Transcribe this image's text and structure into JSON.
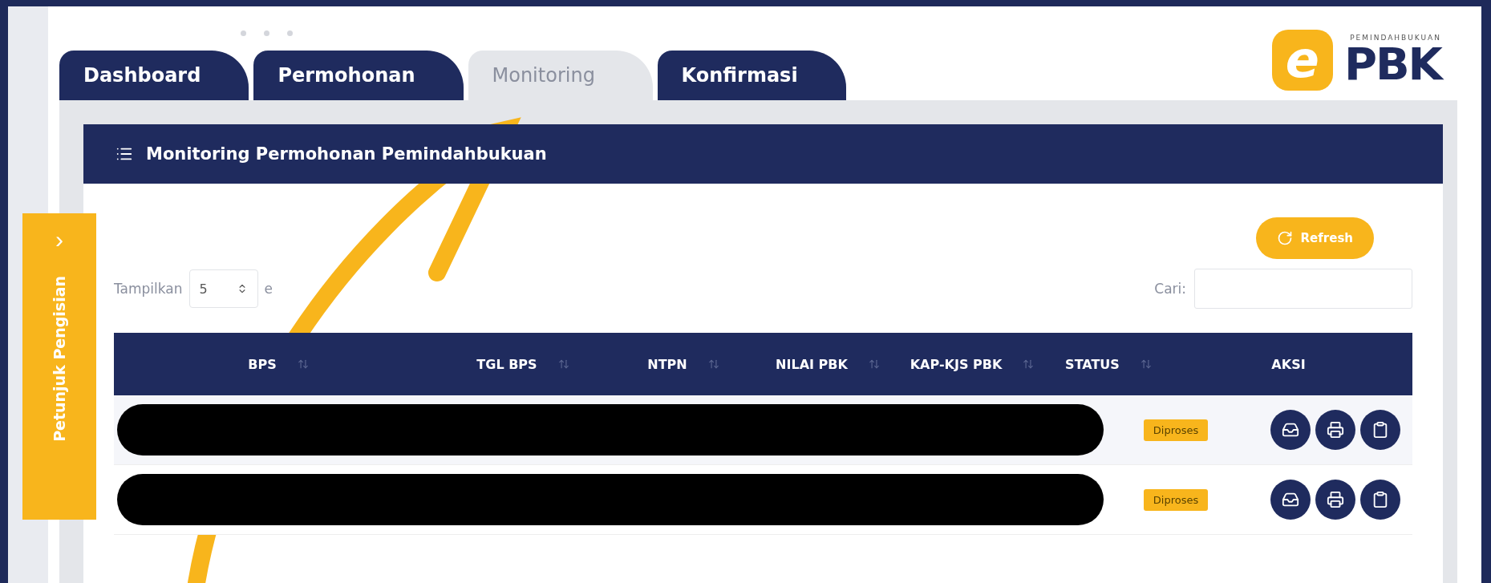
{
  "logo": {
    "mark": "e",
    "caption": "PEMINDAHBUKUAN",
    "name": "PBK"
  },
  "side_tab": {
    "label": "Petunjuk Pengisian",
    "icon": "›"
  },
  "tabs": [
    {
      "label": "Dashboard",
      "selected": false
    },
    {
      "label": "Permohonan",
      "selected": false
    },
    {
      "label": "Monitoring",
      "selected": true
    },
    {
      "label": "Konfirmasi",
      "selected": false
    }
  ],
  "panel": {
    "title": "Monitoring Permohonan Pemindahbukuan",
    "refresh": "Refresh"
  },
  "length": {
    "label": "Tampilkan",
    "value": "5",
    "suffix": "e"
  },
  "search": {
    "label": "Cari:"
  },
  "table": {
    "columns": [
      {
        "label": "BPS",
        "sortable": true
      },
      {
        "label": "TGL BPS",
        "sortable": true
      },
      {
        "label": "NTPN",
        "sortable": true
      },
      {
        "label": "NILAI PBK",
        "sortable": true
      },
      {
        "label": "KAP-KJS PBK",
        "sortable": true
      },
      {
        "label": "STATUS",
        "sortable": true
      },
      {
        "label": "AKSI",
        "sortable": false
      }
    ],
    "rows": [
      {
        "status": "Diproses"
      },
      {
        "status": "Diproses"
      }
    ]
  }
}
